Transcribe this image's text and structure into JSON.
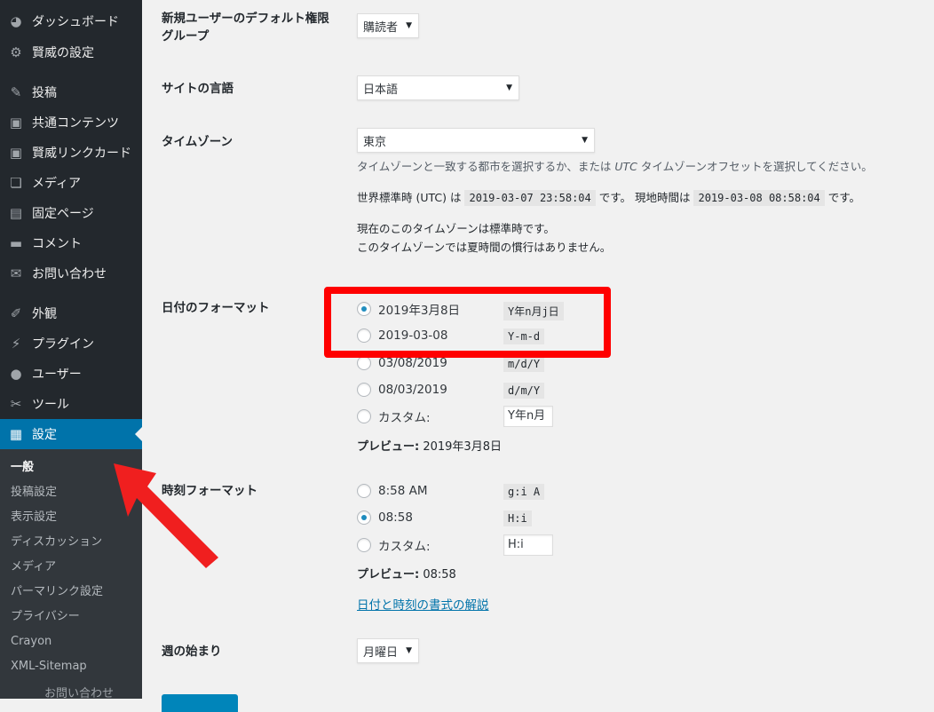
{
  "sidebar": {
    "items": [
      {
        "label": "ダッシュボード",
        "icon": "dashboard-icon",
        "glyph": "◕"
      },
      {
        "label": "賢威の設定",
        "icon": "gear-icon",
        "glyph": "⚙"
      },
      {
        "label": "投稿",
        "icon": "pushpin-icon",
        "glyph": "✎"
      },
      {
        "label": "共通コンテンツ",
        "icon": "code-icon",
        "glyph": "▣"
      },
      {
        "label": "賢威リンクカード",
        "icon": "code-icon",
        "glyph": "▣"
      },
      {
        "label": "メディア",
        "icon": "media-icon",
        "glyph": "❏"
      },
      {
        "label": "固定ページ",
        "icon": "page-icon",
        "glyph": "▤"
      },
      {
        "label": "コメント",
        "icon": "comment-icon",
        "glyph": "▬"
      },
      {
        "label": "お問い合わせ",
        "icon": "mail-icon",
        "glyph": "✉"
      },
      {
        "label": "外観",
        "icon": "brush-icon",
        "glyph": "✐"
      },
      {
        "label": "プラグイン",
        "icon": "plugin-icon",
        "glyph": "⚡"
      },
      {
        "label": "ユーザー",
        "icon": "user-icon",
        "glyph": "●"
      },
      {
        "label": "ツール",
        "icon": "wrench-icon",
        "glyph": "✂"
      },
      {
        "label": "設定",
        "icon": "settings-icon",
        "glyph": "▦"
      }
    ],
    "submenu": [
      "一般",
      "投稿設定",
      "表示設定",
      "ディスカッション",
      "メディア",
      "パーマリンク設定",
      "プライバシー",
      "Crayon",
      "XML-Sitemap"
    ],
    "submenu_partial": "お問い合わせ"
  },
  "settings": {
    "default_role": {
      "label": "新規ユーザーのデフォルト権限グループ",
      "value": "購読者"
    },
    "site_language": {
      "label": "サイトの言語",
      "value": "日本語"
    },
    "timezone": {
      "label": "タイムゾーン",
      "value": "東京",
      "desc_pre": "タイムゾーンと一致する都市を選択するか、または ",
      "desc_utc": "UTC",
      "desc_post": " タイムゾーンオフセットを選択してください。",
      "utc_label": "世界標準時 (UTC) は",
      "utc_time": "2019-03-07 23:58:04",
      "utc_suffix": "です。",
      "local_label": "現地時間は",
      "local_time": "2019-03-08 08:58:04",
      "local_suffix": "です。",
      "dst_line1": "現在のこのタイムゾーンは標準時です。",
      "dst_line2": "このタイムゾーンでは夏時間の慣行はありません。"
    },
    "date_format": {
      "label": "日付のフォーマット",
      "options": [
        {
          "label": "2019年3月8日",
          "code": "Y年n月j日",
          "checked": true
        },
        {
          "label": "2019-03-08",
          "code": "Y-m-d",
          "checked": false
        },
        {
          "label": "03/08/2019",
          "code": "m/d/Y",
          "checked": false
        },
        {
          "label": "08/03/2019",
          "code": "d/m/Y",
          "checked": false
        },
        {
          "label": "カスタム:",
          "input": "Y年n月",
          "checked": false
        }
      ],
      "preview_label": "プレビュー:",
      "preview_value": " 2019年3月8日"
    },
    "time_format": {
      "label": "時刻フォーマット",
      "options": [
        {
          "label": "8:58 AM",
          "code": "g:i A",
          "checked": false
        },
        {
          "label": "08:58",
          "code": "H:i",
          "checked": true
        },
        {
          "label": "カスタム:",
          "input": "H:i",
          "checked": false
        }
      ],
      "preview_label": "プレビュー:",
      "preview_value": " 08:58",
      "doc_link": "日付と時刻の書式の解説"
    },
    "week_start": {
      "label": "週の始まり",
      "value": "月曜日"
    }
  },
  "colors": {
    "sidebar_bg": "#23282d",
    "submenu_bg": "#32373c",
    "active_bg": "#0073aa",
    "annotation": "#ff0000",
    "radio_dot": "#1e8cbe"
  }
}
